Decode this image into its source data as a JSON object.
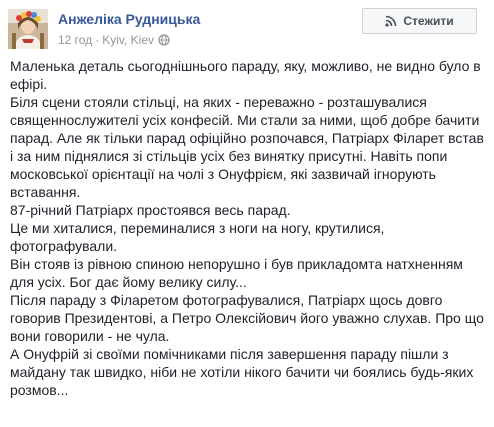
{
  "post": {
    "author": "Анжеліка Рудницька",
    "time": "12 год",
    "separator": "·",
    "location": "Kyiv, Kiev",
    "follow_label": "Стежити",
    "icons": {
      "avatar": "avatar-photo",
      "privacy": "globe-icon",
      "follow": "rss-icon"
    },
    "paragraphs": [
      "Маленька деталь сьогоднішнього параду, яку, можливо, не видно було в ефірі.",
      "Біля сцени стояли стільці, на яких - переважно - розташувалися священнослужителі усіх конфесій. Ми стали за ними, щоб добре бачити парад. Але як тільки парад офіційно розпочався, Патріарх Філарет встав і за ним піднялися зі стільців усіх без винятку присутні. Навіть попи московської орієнтації на чолі з Онуфрієм, які зазвичай ігнорують вставання.",
      "87-річний Патріарх простоявся весь парад.",
      "Це ми хиталися, переминалися з ноги на ногу, крутилися, фотографували.",
      "Він стояв із рівною спиною непорушно і був прикладомта натхненням для усіх. Бог дає йому велику силу...",
      "Після параду з Філаретом фотографувалися, Патріарх щось довго говорив Президентові, а Петро Олексійович його уважно слухав. Про що вони говорили - не чула.",
      "А Онуфрій зі своїми помічниками після завершення параду пішли з майдану так швидко, ніби не хотіли нікого бачити чи боялись будь-яких розмов..."
    ]
  },
  "colors": {
    "link": "#365899",
    "meta": "#90949c",
    "text": "#1d2129"
  }
}
